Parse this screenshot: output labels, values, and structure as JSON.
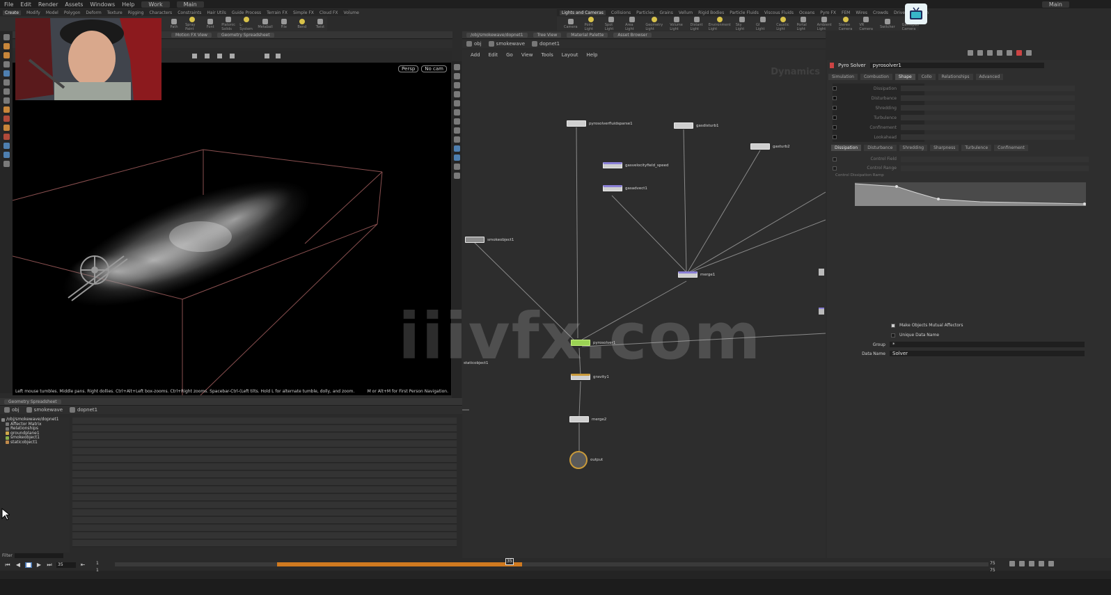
{
  "menubar": {
    "items": [
      "File",
      "Edit",
      "Render",
      "Assets",
      "Windows",
      "Help"
    ],
    "desktop": "Work",
    "build": "Main",
    "right_label": "Main"
  },
  "shelf_left": {
    "tabs": [
      "Create",
      "Modify",
      "Model",
      "Polygon",
      "Deform",
      "Texture",
      "Rigging",
      "Characters",
      "Constraints",
      "Hair Utils",
      "Guide Process",
      "Terrain FX",
      "Simple FX",
      "Cloud FX",
      "Volume"
    ],
    "active_tab": 0,
    "tools": [
      "Path",
      "Spray Paint",
      "Font",
      "Platonic Solids",
      "L-System",
      "Metaball",
      "File",
      "Bend",
      "Twist"
    ]
  },
  "shelf_right": {
    "tabs": [
      "Lights and Cameras",
      "Collisions",
      "Particles",
      "Grains",
      "Vellum",
      "Rigid Bodies",
      "Particle Fluids",
      "Viscous Fluids",
      "Oceans",
      "Pyro FX",
      "FEM",
      "Wires",
      "Crowds",
      "Drive Simulation"
    ],
    "active_tab": 0,
    "tools": [
      "Camera",
      "Point Light",
      "Spot Light",
      "Area Light",
      "Geometry Light",
      "Volume Light",
      "Distant Light",
      "Environment Light",
      "Sky Light",
      "GI Light",
      "Caustic Light",
      "Portal Light",
      "Ambient Light",
      "Stereo Camera",
      "VR Camera",
      "Switcher",
      "Gamepad Camera"
    ]
  },
  "scene_pane": {
    "tabs": [
      "Motion FX View",
      "Geometry Spreadsheet"
    ]
  },
  "viewport": {
    "persp_label": "Persp",
    "cam_label": "No cam",
    "hint": "Left mouse tumbles. Middle pans. Right dollies. Ctrl+Alt+Left box-zooms. Ctrl+Right zooms. Spacebar-Ctrl-(Left tilts. Hold L for alternate tumble, dolly, and zoom.",
    "hint_right": "M or Alt+M for First Person Navigation."
  },
  "spreadsheet": {
    "title": "Geometry Spreadsheet",
    "path": [
      "obj",
      "smokewave",
      "dopnet1"
    ],
    "tree": [
      {
        "label": "/obj/smokewave/dopnet1",
        "color": "#888888"
      },
      {
        "label": "Affector Matrix",
        "color": "#777777"
      },
      {
        "label": "Relationships",
        "color": "#777777"
      },
      {
        "label": "groundplane1",
        "color": "#d0a84a"
      },
      {
        "label": "smokeobject1",
        "color": "#8ab04a"
      },
      {
        "label": "staticobject1",
        "color": "#c08a4a"
      }
    ],
    "filter_label": "Filter"
  },
  "network": {
    "tabs": [
      "/obj/smokewave/dopnet1",
      "Tree View",
      "Material Palette",
      "Asset Browser"
    ],
    "path": [
      "obj",
      "smokewave",
      "dopnet1"
    ],
    "menus": [
      "Add",
      "Edit",
      "Go",
      "View",
      "Tools",
      "Layout",
      "Help"
    ],
    "context_label": "Dynamics",
    "nodes": {
      "pyrosolver_node": "pyrosolverfluidsparse1",
      "gasdisturb": "gasdisturb1",
      "gasturb": "gasturb2",
      "gasvelocityfield": "gasvelocityfield_speed",
      "gasadvect": "gasadvect1",
      "smokeobject": "smokeobject1",
      "merge1": "merge1",
      "pyrosolver": "pyrosolver1",
      "staticobject": "staticobject1",
      "gravity": "gravity1",
      "merge2": "merge2",
      "output": "output"
    }
  },
  "parameters": {
    "node_type": "Pyro Solver",
    "node_name": "pyrosolver1",
    "tabs": [
      "Simulation",
      "Combustion",
      "Shape",
      "Collo",
      "Relationships",
      "Advanced"
    ],
    "active_tab": 2,
    "shape_rows": [
      "Dissipation",
      "Disturbance",
      "Shredding",
      "Turbulence",
      "Confinement",
      "Lookahead"
    ],
    "subtabs": [
      "Dissipation",
      "Disturbance",
      "Shredding",
      "Sharpness",
      "Turbulence",
      "Confinement"
    ],
    "active_subtab": 0,
    "sub_rows": [
      "Control Field",
      "Control Range"
    ],
    "ramp_label": "Control Dissipation Ramp",
    "bottom": {
      "mutual_label": "Make Objects Mutual Affectors",
      "unique_label": "Unique Data Name",
      "group_label": "Group",
      "group_value": "*",
      "dataname_label": "Data Name",
      "dataname_value": "Solver"
    }
  },
  "timeline": {
    "frame": "35",
    "start": "1",
    "start2": "1",
    "end": "75",
    "end2": "75",
    "playhead_label": "35"
  },
  "watermark": "iiivfx.com",
  "colors": {
    "cache_bar": "#d07a20",
    "node_green": "#9ad254",
    "panel": "#2e2e2e"
  }
}
